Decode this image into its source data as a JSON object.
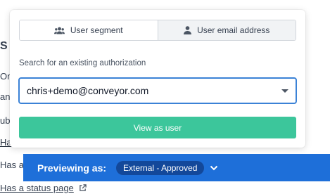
{
  "background": {
    "heading_fragment": "S",
    "line1": "One",
    "line2": "ann",
    "line3": "ub",
    "line4": "Has",
    "line5": "Has an",
    "line6": "Has a status page"
  },
  "popover": {
    "tabs": [
      {
        "label": "User segment",
        "icon": "users-icon",
        "active": true
      },
      {
        "label": "User email address",
        "icon": "user-icon",
        "active": false
      }
    ],
    "search_label": "Search for an existing authorization",
    "selected_value": "chris+demo@conveyor.com",
    "button_label": "View as user",
    "colors": {
      "button": "#3cc69b",
      "select_border": "#3b82d6"
    }
  },
  "preview_bar": {
    "label": "Previewing as:",
    "badge": "External - Approved",
    "colors": {
      "bar": "#1e6fd9",
      "badge": "#13489a"
    }
  }
}
